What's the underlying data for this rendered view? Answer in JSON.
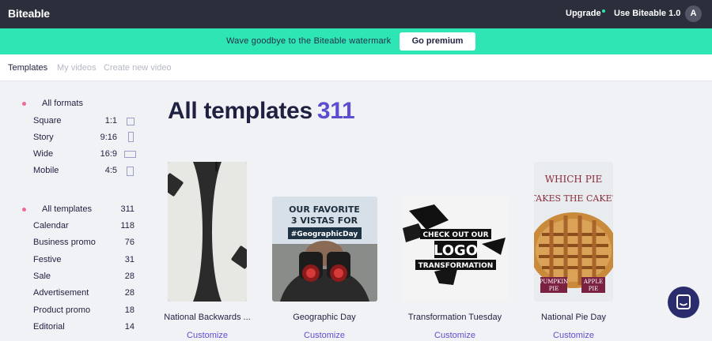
{
  "topbar": {
    "logo": "Biteable",
    "upgrade": "Upgrade",
    "use_biteable": "Use Biteable 1.0",
    "avatar_initial": "A",
    "dot_color": "#2fe5b2"
  },
  "banner": {
    "text": "Wave goodbye to the Biteable watermark",
    "button": "Go premium",
    "color": "#2ee6b4"
  },
  "tabs": [
    {
      "label": "Templates",
      "active": true
    },
    {
      "label": "My videos",
      "active": false
    },
    {
      "label": "Create new video",
      "active": false
    }
  ],
  "sidebar": {
    "formats": [
      {
        "label": "All formats",
        "ratio": "",
        "icon": "bullet"
      },
      {
        "label": "Square",
        "ratio": "1:1",
        "icon": "square-icon"
      },
      {
        "label": "Story",
        "ratio": "9:16",
        "icon": "story-icon"
      },
      {
        "label": "Wide",
        "ratio": "16:9",
        "icon": "wide-icon"
      },
      {
        "label": "Mobile",
        "ratio": "4:5",
        "icon": "mobile-icon"
      }
    ],
    "categories": [
      {
        "label": "All templates",
        "count": "311"
      },
      {
        "label": "Calendar",
        "count": "118"
      },
      {
        "label": "Business promo",
        "count": "76"
      },
      {
        "label": "Festive",
        "count": "31"
      },
      {
        "label": "Sale",
        "count": "28"
      },
      {
        "label": "Advertisement",
        "count": "28"
      },
      {
        "label": "Product promo",
        "count": "18"
      },
      {
        "label": "Editorial",
        "count": "14"
      }
    ]
  },
  "main": {
    "heading": "All templates",
    "count": "311"
  },
  "cards": [
    {
      "title": "National Backwards ...",
      "link": "Customize",
      "thumb_text": []
    },
    {
      "title": "Geographic Day",
      "link": "Customize",
      "thumb_text": [
        "OUR FAVORITE",
        "3 VISTAS FOR",
        "#GeographicDay"
      ]
    },
    {
      "title": "Transformation Tuesday",
      "link": "Customize",
      "thumb_text": [
        "CHECK OUT OUR",
        "LOGO",
        "TRANSFORMATION"
      ]
    },
    {
      "title": "National Pie Day",
      "link": "Customize",
      "thumb_text": [
        "WHICH PIE",
        "TAKES THE CAKE?",
        "PUMPKIN",
        "PIE",
        "APPLE",
        "PIE"
      ]
    }
  ],
  "colors": {
    "accent": "#5b4fcf",
    "topbar": "#2b2f3b",
    "bullet": "#f16a97"
  }
}
